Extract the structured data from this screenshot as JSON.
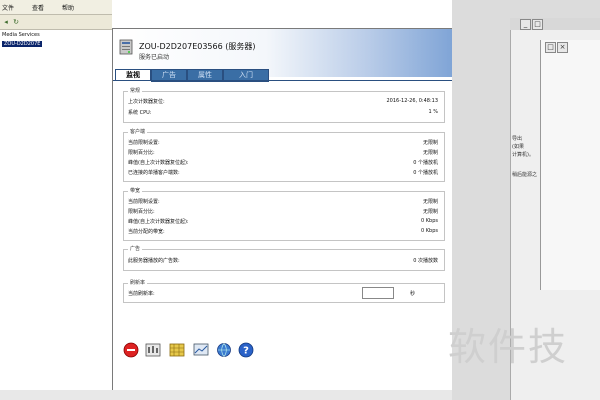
{
  "menu": {
    "file": "文件",
    "view": "查看",
    "help": "帮助"
  },
  "tree": {
    "item1": "Media Services",
    "item2": "ZOU-D2D207E"
  },
  "server": {
    "title": "ZOU-D2D207E03566 (服务器)",
    "status": "服务已启动"
  },
  "tabs": [
    "监视",
    "广告",
    "属性",
    "入门"
  ],
  "sections": {
    "general": {
      "title": "常规",
      "rows": [
        {
          "label": "上次计数器复位:",
          "value": "2016-12-26, 0:48:13"
        },
        {
          "label": "系统 CPU:",
          "value": "1 %"
        }
      ]
    },
    "clients": {
      "title": "客户端",
      "rows": [
        {
          "label": "当前限制设置:",
          "value": "无限制"
        },
        {
          "label": "限制百分比:",
          "value": "无限制"
        },
        {
          "label": "峰值(自上次计数器复位起):",
          "value": "0 个播放机"
        },
        {
          "label": "已连接的单播客户端数:",
          "value": "0 个播放机"
        }
      ]
    },
    "bandwidth": {
      "title": "带宽",
      "rows": [
        {
          "label": "当前限制设置:",
          "value": "无限制"
        },
        {
          "label": "限制百分比:",
          "value": "无限制"
        },
        {
          "label": "峰值(自上次计数器复位起):",
          "value": "0 Kbps"
        },
        {
          "label": "当前分配的带宽:",
          "value": "0 Kbps"
        }
      ]
    },
    "ads": {
      "title": "广告",
      "rows": [
        {
          "label": "此服务器播放的广告数:",
          "value": "0 次播放数"
        }
      ]
    },
    "refresh": {
      "title": "刷新率",
      "label": "当前刷新率:",
      "unit": "秒"
    }
  },
  "right": {
    "fragment1": "导出",
    "fragment2": "(如果",
    "fragment3": "计算机)。",
    "fragment4": "稍后能源之"
  },
  "watermark": "软件技",
  "colors": {
    "accent": "#3a6ea5",
    "header_blue": "#7fa4d6"
  }
}
